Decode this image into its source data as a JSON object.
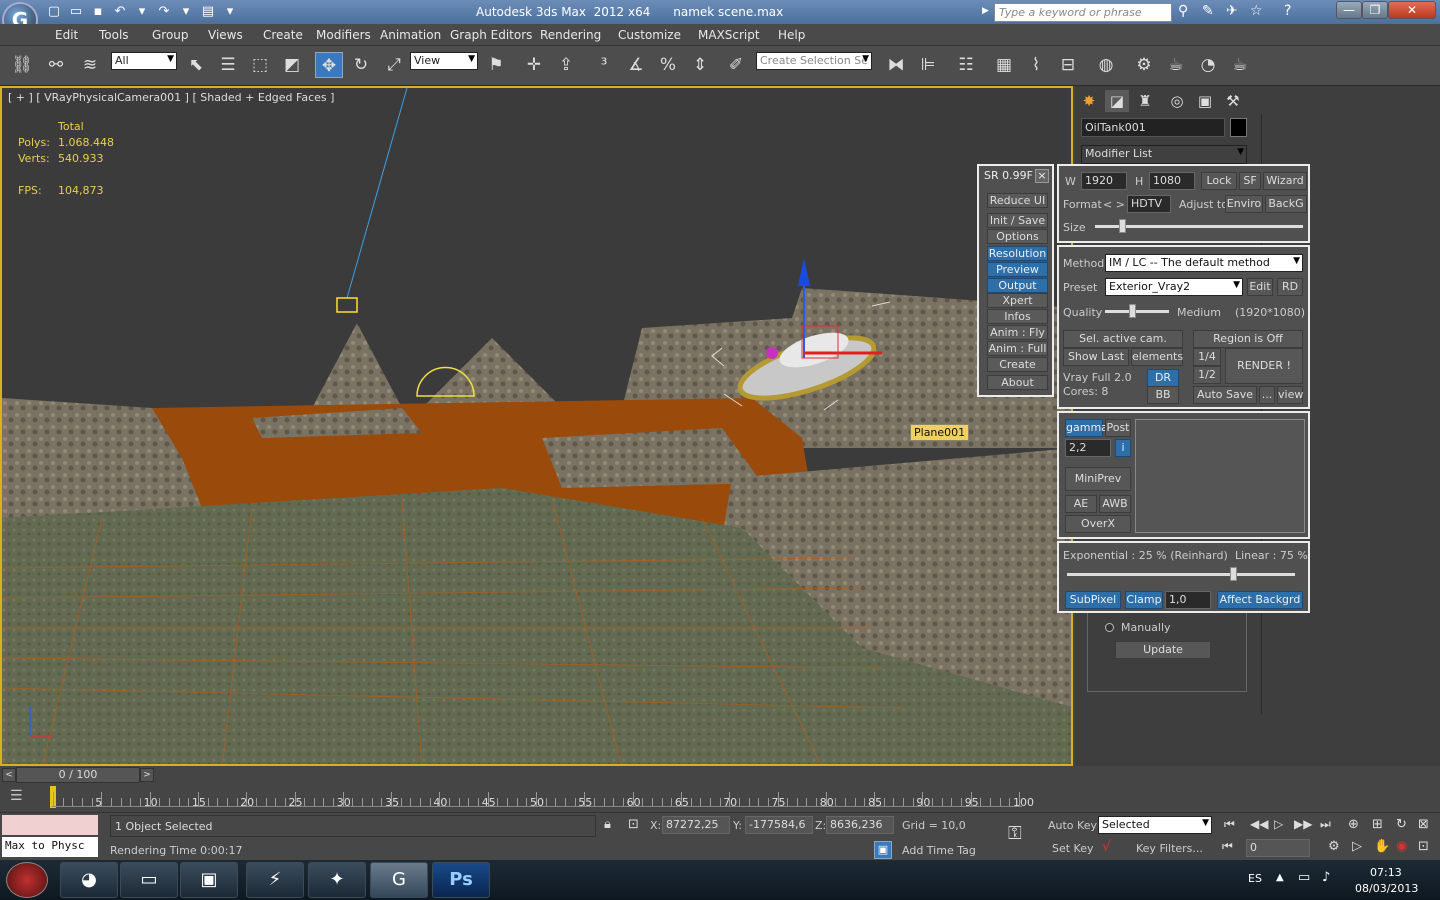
{
  "window": {
    "app_title": "Autodesk 3ds Max  2012 x64",
    "file_name": "namek scene.max",
    "search_placeholder": "Type a keyword or phrase"
  },
  "menu": [
    "Edit",
    "Tools",
    "Group",
    "Views",
    "Create",
    "Modifiers",
    "Animation",
    "Graph Editors",
    "Rendering",
    "Customize",
    "MAXScript",
    "Help"
  ],
  "toolbar": {
    "filter_value": "All",
    "refcoord_value": "View",
    "selection_set_placeholder": "Create Selection Se"
  },
  "viewport": {
    "label": "[ + ] [ VRayPhysicalCamera001 ] [ Shaded + Edged Faces ]",
    "stats_total": "Total",
    "polys_label": "Polys:",
    "polys_value": "1.068.448",
    "verts_label": "Verts:",
    "verts_value": "540.933",
    "fps_label": "FPS:",
    "fps_value": "104,873",
    "object_tag": "Plane001"
  },
  "sr_panel": {
    "title": "SR 0.99F",
    "close": "×",
    "buttons": [
      "Reduce UI",
      "Init / Save",
      "Options",
      "Resolution",
      "Preview",
      "Output",
      "Xpert",
      "Infos",
      "Anim : Fly",
      "Anim : Full",
      "Create",
      "About"
    ]
  },
  "command_panel": {
    "object_name": "OilTank001",
    "modifier_list": "Modifier List",
    "res": {
      "w_label": "W",
      "w_value": "1920",
      "h_label": "H",
      "h_value": "1080",
      "lock": "Lock",
      "sf": "SF",
      "wizard": "Wizard",
      "format_label": "Format",
      "format_arrows": "< >",
      "format_value": "HDTV",
      "adjust_label": "Adjust to",
      "enviro": "Enviro",
      "backg": "BackG",
      "size_label": "Size",
      "size_fraction": 0.1
    },
    "render": {
      "method_label": "Method",
      "method_value": "IM / LC -- The default method",
      "preset_label": "Preset",
      "preset_value": "Exterior_Vray2",
      "edit": "Edit",
      "rd": "RD",
      "quality_label": "Quality",
      "quality_value": "Medium",
      "quality_res": "(1920*1080)",
      "quality_fraction": 0.3,
      "sel_cam": "Sel. active cam.",
      "region": "Region is Off",
      "show_last": "Show Last",
      "elements": "elements",
      "quarter": "1/4",
      "half": "1/2",
      "render_btn": "RENDER !",
      "vray_info": "Vray  Full 2.0",
      "cores": "Cores:  8",
      "dr": "DR",
      "bb": "BB",
      "auto_save": "Auto Save",
      "ellipsis": "...",
      "view": "view"
    },
    "color": {
      "gamma": "gamma",
      "post": "Post",
      "gamma_value": "2,2",
      "info": "i",
      "miniprev": "MiniPrev",
      "ae": "AE",
      "awb": "AWB",
      "overx": "OverX"
    },
    "exposure": {
      "exponential": "Exponential : 25 %  (Reinhard)",
      "linear": "Linear : 75 %",
      "mix_fraction": 0.75,
      "subpixel": "SubPixel",
      "clamp": "Clamp",
      "clamp_value": "1,0",
      "affect": "Affect Backgrd"
    },
    "update": {
      "manually": "Manually",
      "update_btn": "Update"
    }
  },
  "timeline": {
    "frame": "0 / 100",
    "ticks": [
      "5",
      "10",
      "15",
      "20",
      "25",
      "30",
      "35",
      "40",
      "45",
      "50",
      "55",
      "60",
      "65",
      "70",
      "75",
      "80",
      "85",
      "90",
      "95",
      "100"
    ]
  },
  "status": {
    "maxscript": "Max to Physc",
    "selected_count": "1 Object Selected",
    "render_time": "Rendering Time  0:00:17",
    "x_label": "X:",
    "x_value": "87272,25",
    "y_label": "Y:",
    "y_value": "-177584,6",
    "z_label": "Z:",
    "z_value": "8636,236",
    "grid": "Grid = 10,0",
    "add_time_tag": "Add Time Tag",
    "auto_key": "Auto Key",
    "selected_value": "Selected",
    "set_key": "Set Key",
    "key_filters": "Key Filters...",
    "frame_value": "0"
  },
  "taskbar": {
    "lang": "ES",
    "time": "07:13",
    "date": "08/03/2013"
  }
}
